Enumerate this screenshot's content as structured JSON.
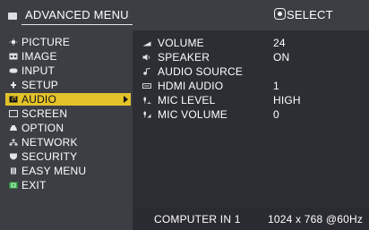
{
  "header": {
    "title": "ADVANCED MENU",
    "select_label": "SELECT",
    "select_icon": "dpad-center-icon"
  },
  "menu": {
    "items": [
      {
        "label": "PICTURE",
        "icon": "sun-picture-icon"
      },
      {
        "label": "IMAGE",
        "icon": "image-icon"
      },
      {
        "label": "INPUT",
        "icon": "input-icon"
      },
      {
        "label": "SETUP",
        "icon": "setup-icon"
      },
      {
        "label": "AUDIO",
        "icon": "audio-icon"
      },
      {
        "label": "SCREEN",
        "icon": "screen-icon"
      },
      {
        "label": "OPTION",
        "icon": "option-icon"
      },
      {
        "label": "NETWORK",
        "icon": "network-icon"
      },
      {
        "label": "SECURITY",
        "icon": "security-icon"
      },
      {
        "label": "EASY MENU",
        "icon": "easy-menu-icon"
      },
      {
        "label": "EXIT",
        "icon": "exit-icon"
      }
    ],
    "active_index": 4,
    "active_color": "#e2c22b"
  },
  "audio": {
    "rows": [
      {
        "label": "VOLUME",
        "value": "24",
        "icon": "volume-bar-icon"
      },
      {
        "label": "SPEAKER",
        "value": "ON",
        "icon": "speaker-icon"
      },
      {
        "label": "AUDIO SOURCE",
        "value": "",
        "icon": "audio-source-icon"
      },
      {
        "label": "HDMI AUDIO",
        "value": "1",
        "icon": "hdmi-audio-icon"
      },
      {
        "label": "MIC LEVEL",
        "value": "HIGH",
        "icon": "mic-level-icon"
      },
      {
        "label": "MIC VOLUME",
        "value": "0",
        "icon": "mic-volume-icon"
      }
    ]
  },
  "status": {
    "source": "COMPUTER IN 1",
    "resolution": "1024 x 768 @60Hz"
  },
  "colors": {
    "panel_bg": "#3c3e43",
    "content_bg": "#2c2e33",
    "text": "#ffffff",
    "highlight": "#e2c22b"
  }
}
